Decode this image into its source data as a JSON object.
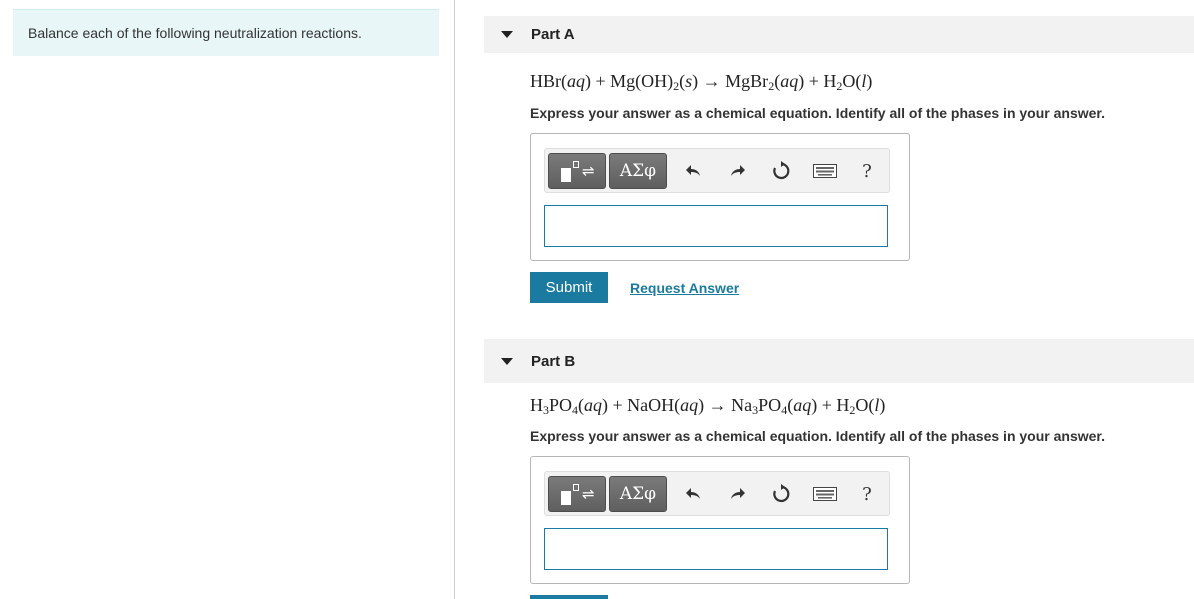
{
  "instructions": "Balance each of the following neutralization reactions.",
  "parts": [
    {
      "title": "Part A",
      "equation": {
        "lhs1": "HBr",
        "lhs1_phase": "aq",
        "lhs2_pre": "Mg(OH)",
        "lhs2_sub": "2",
        "lhs2_phase": "s",
        "rhs1_pre": "MgBr",
        "rhs1_sub": "2",
        "rhs1_phase": "aq",
        "rhs2_pre": "H",
        "rhs2_sub": "2",
        "rhs2_post": "O",
        "rhs2_phase": "l"
      },
      "prompt": "Express your answer as a chemical equation. Identify all of the phases in your answer.",
      "answer_value": "",
      "submit_label": "Submit",
      "request_label": "Request Answer"
    },
    {
      "title": "Part B",
      "equation": {
        "lhs1_pre": "H",
        "lhs1_sub": "3",
        "lhs1_post": "PO",
        "lhs1_sub2": "4",
        "lhs1_phase": "aq",
        "lhs2": "NaOH",
        "lhs2_phase": "aq",
        "rhs1_pre": "Na",
        "rhs1_sub": "3",
        "rhs1_post": "PO",
        "rhs1_sub2": "4",
        "rhs1_phase": "aq",
        "rhs2_pre": "H",
        "rhs2_sub": "2",
        "rhs2_post": "O",
        "rhs2_phase": "l"
      },
      "prompt": "Express your answer as a chemical equation. Identify all of the phases in your answer.",
      "answer_value": ""
    }
  ],
  "toolbar": {
    "greek_label": "ΑΣφ",
    "help_label": "?",
    "arrows_glyph": "⇌",
    "icons": [
      "templates-icon",
      "greek-symbols-icon",
      "undo-icon",
      "redo-icon",
      "reset-icon",
      "keyboard-icon",
      "help-icon"
    ]
  },
  "symbols": {
    "plus": "+",
    "arrow": "→"
  },
  "colors": {
    "accent": "#1a7a9f",
    "instructions_bg": "#e8f6f8",
    "header_bg": "#f2f2f2",
    "button_gray": "#6b6b6b"
  }
}
